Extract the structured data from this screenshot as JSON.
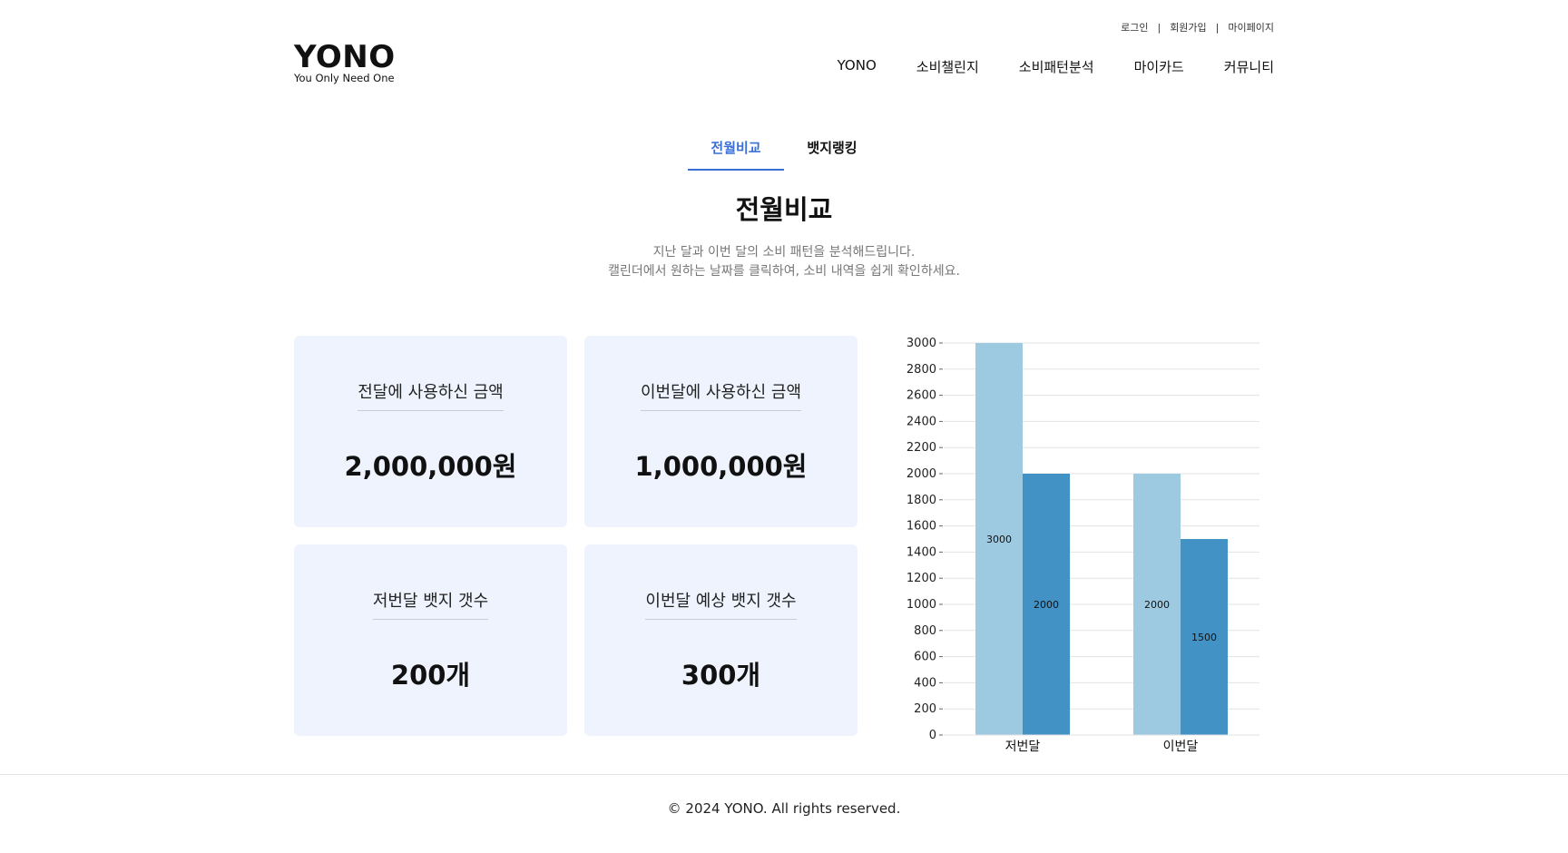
{
  "header": {
    "util_links": [
      "로그인",
      "회원가입",
      "마이페이지"
    ],
    "util_separator": "|",
    "logo_title": "YONO",
    "logo_subtitle": "You Only Need One",
    "nav": [
      "YONO",
      "소비챌린지",
      "소비패턴분석",
      "마이카드",
      "커뮤니티"
    ]
  },
  "tabs": [
    {
      "label": "전월비교",
      "active": true
    },
    {
      "label": "뱃지랭킹",
      "active": false
    }
  ],
  "page_title": "전월비교",
  "description": [
    "지난 달과 이번 달의 소비 패턴을 분석해드립니다.",
    "캘린더에서 원하는 날짜를 클릭하여, 소비 내역을 쉽게 확인하세요."
  ],
  "cards": [
    {
      "label": "전달에 사용하신 금액",
      "value": "2,000,000원"
    },
    {
      "label": "이번달에 사용하신 금액",
      "value": "1,000,000원"
    },
    {
      "label": "저번달 뱃지 갯수",
      "value": "200개"
    },
    {
      "label": "이번달 예상 뱃지 갯수",
      "value": "300개"
    }
  ],
  "chart_data": {
    "type": "bar",
    "categories": [
      "저번달",
      "이번달"
    ],
    "series": [
      {
        "values": [
          3000,
          2000
        ],
        "color": "#9ecae1"
      },
      {
        "values": [
          2000,
          1500
        ],
        "color": "#4292c6"
      }
    ],
    "ylim": [
      0,
      3000
    ],
    "yticks": [
      0,
      200,
      400,
      600,
      800,
      1000,
      1200,
      1400,
      1600,
      1800,
      2000,
      2200,
      2400,
      2600,
      2800,
      3000
    ],
    "grid": true,
    "data_labels": true
  },
  "footer": "© 2024 YONO. All rights reserved."
}
